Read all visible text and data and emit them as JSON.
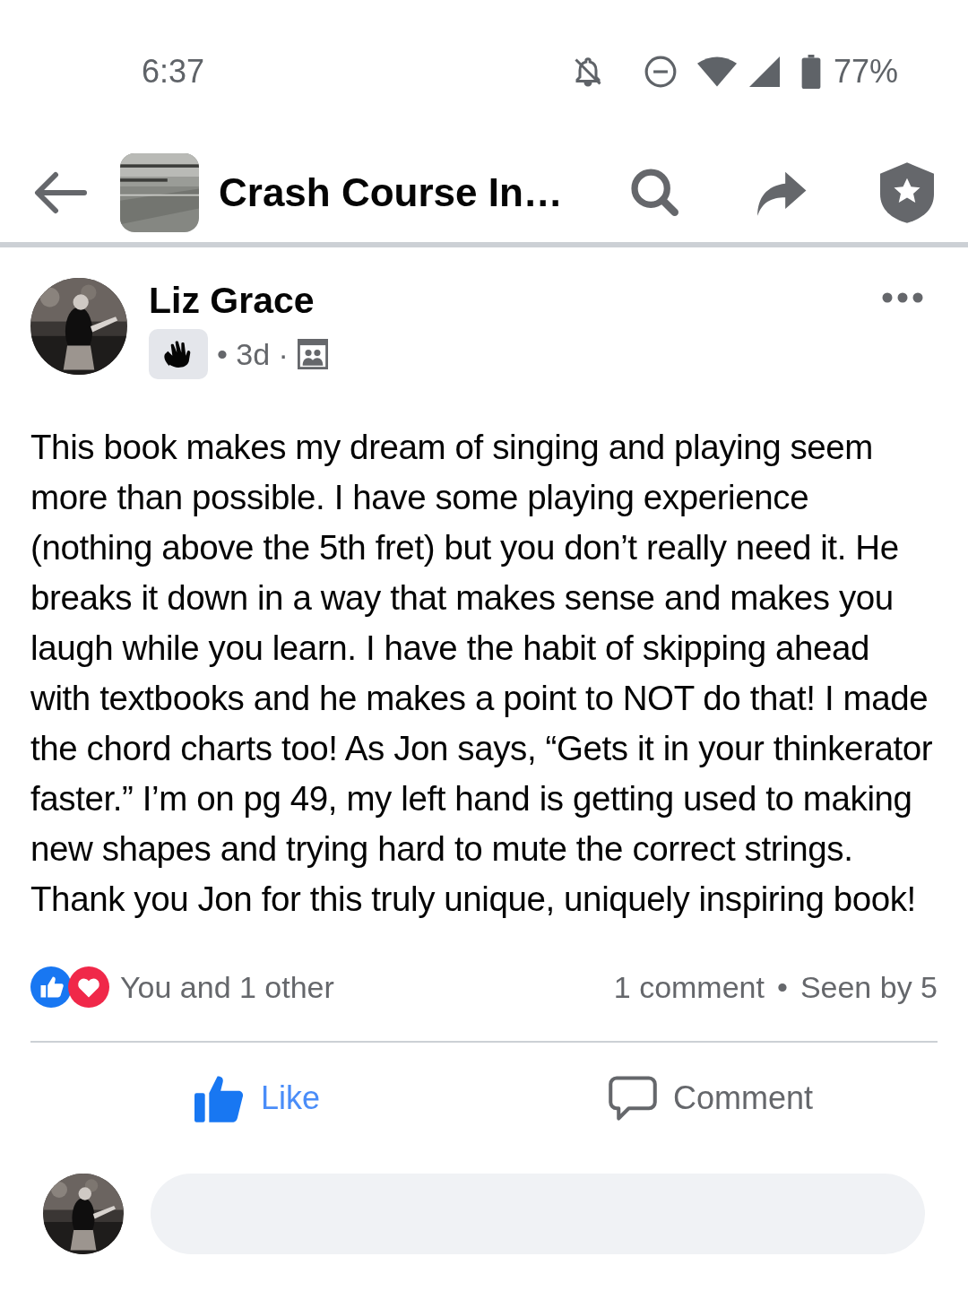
{
  "status_bar": {
    "time": "6:37",
    "battery": "77%"
  },
  "header": {
    "title": "Crash Course In…"
  },
  "post": {
    "author": "Liz Grace",
    "meta": "• 3d ·",
    "text": "This book makes my dream of singing and playing seem more than possible. I have some playing experience (nothing above the 5th fret) but you don’t really need it. He breaks it down in a way that makes sense and makes you laugh while you learn. I have the habit of skipping ahead with textbooks and he makes a point to NOT do that! I made the chord charts too! As Jon says, “Gets it in your thinkerator faster.” I’m on pg 49, my left hand is getting used to making new shapes and trying hard to mute the correct strings. Thank you Jon for this truly unique, uniquely inspiring book!",
    "reactions_summary": "You and 1 other",
    "comments": "1 comment",
    "separator": "•",
    "seen_by": "Seen by 5",
    "actions": [
      {
        "kind": "like",
        "label": "Like",
        "selected": true
      },
      {
        "kind": "comment",
        "label": "Comment",
        "selected": false
      }
    ]
  }
}
